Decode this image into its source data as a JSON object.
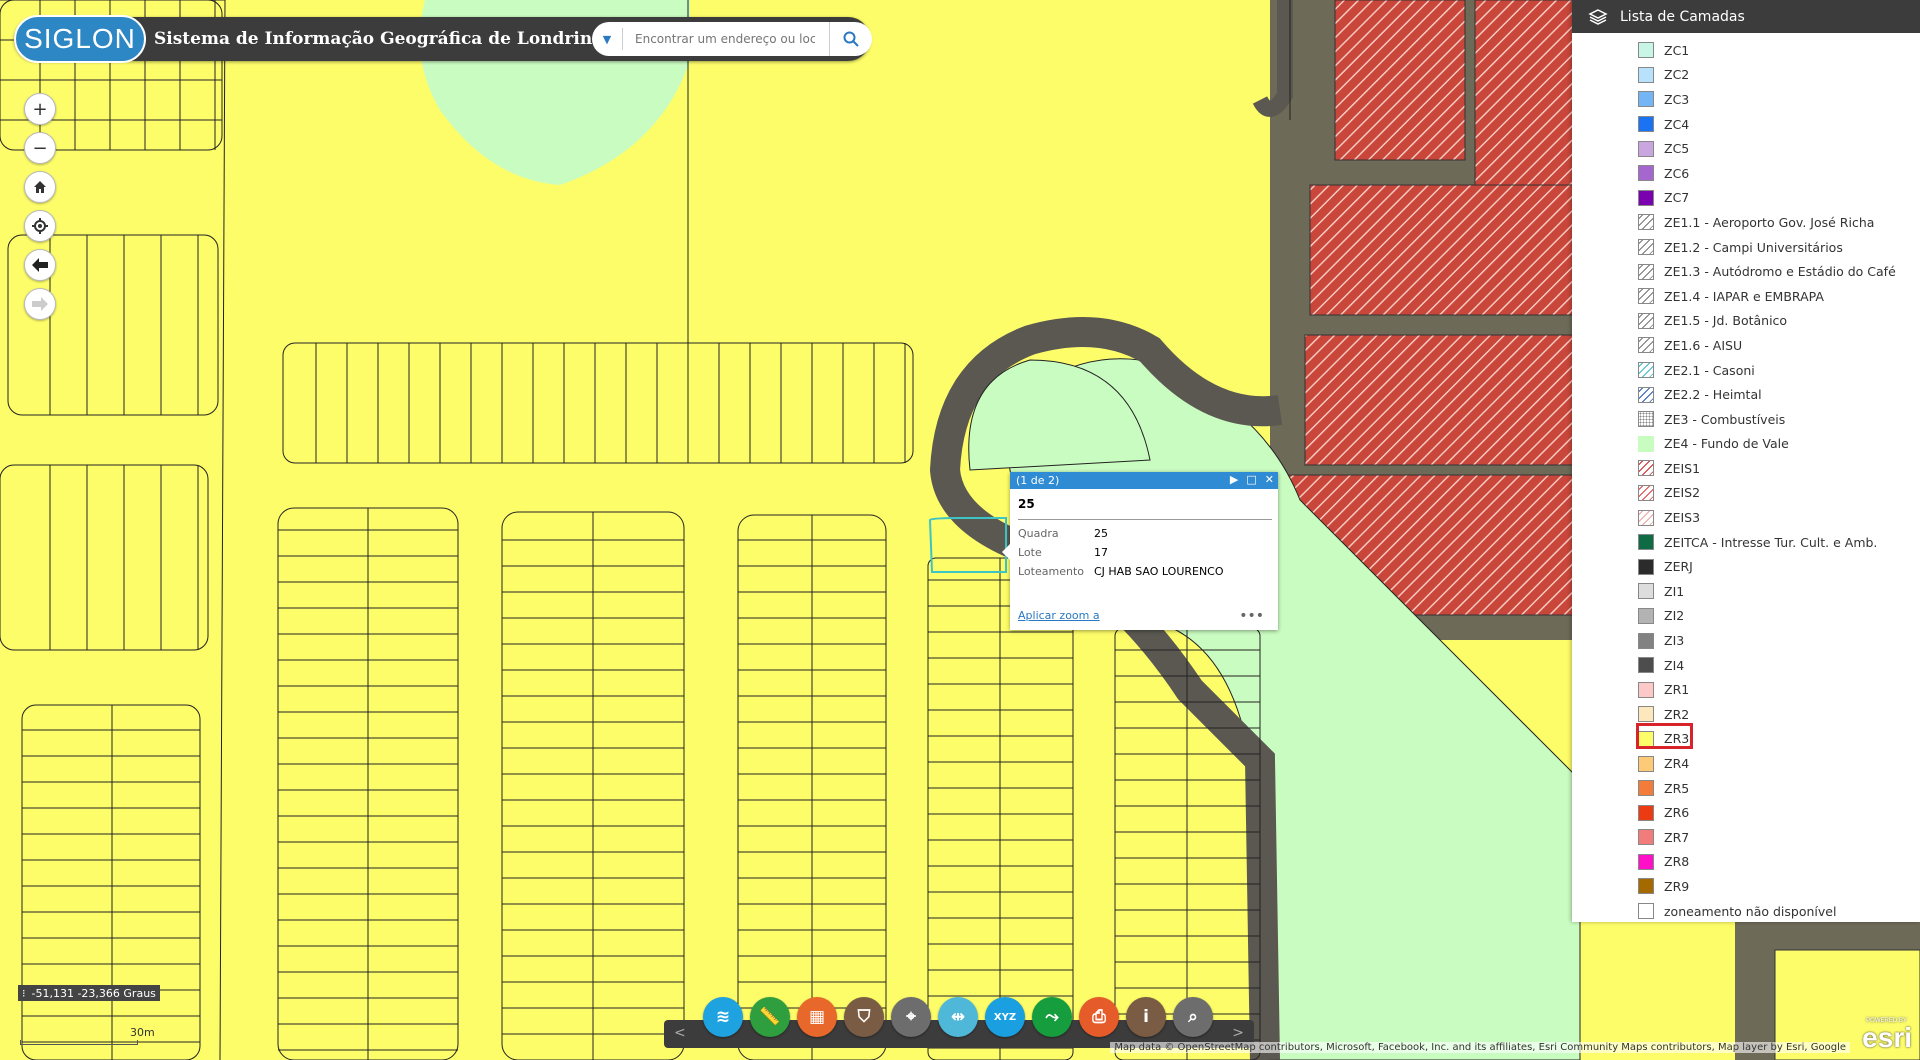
{
  "header": {
    "logo_text": "SIGLON",
    "title": "Sistema de Informação Geográfica de Londrina",
    "search_placeholder": "Encontrar um endereço ou local"
  },
  "map_tools": [
    "plus-icon",
    "minus-icon",
    "home-icon",
    "locate-icon",
    "back-icon",
    "forward-icon"
  ],
  "popup": {
    "header": "(1 de 2)",
    "title": "25",
    "fields": [
      {
        "key": "Quadra",
        "value": "25"
      },
      {
        "key": "Lote",
        "value": "17"
      },
      {
        "key": "Loteamento",
        "value": "CJ HAB SAO LOURENCO"
      }
    ],
    "zoom_link": "Aplicar zoom a",
    "more": "•••"
  },
  "layers_panel": {
    "title": "Lista de Camadas",
    "items": [
      {
        "label": "ZC1",
        "color": "#c8f5e6",
        "pattern": "solid"
      },
      {
        "label": "ZC2",
        "color": "#b8e2fb",
        "pattern": "solid"
      },
      {
        "label": "ZC3",
        "color": "#73b5f5",
        "pattern": "solid"
      },
      {
        "label": "ZC4",
        "color": "#1a73f2",
        "pattern": "solid"
      },
      {
        "label": "ZC5",
        "color": "#c9a6e0",
        "pattern": "solid"
      },
      {
        "label": "ZC6",
        "color": "#a566cf",
        "pattern": "solid"
      },
      {
        "label": "ZC7",
        "color": "#7a00b0",
        "pattern": "solid"
      },
      {
        "label": "ZE1.1 - Aeroporto Gov. José Richa",
        "color": "#777777",
        "pattern": "hatch"
      },
      {
        "label": "ZE1.2 - Campi Universitários",
        "color": "#777777",
        "pattern": "hatch"
      },
      {
        "label": "ZE1.3 - Autódromo e Estádio do Café",
        "color": "#777777",
        "pattern": "hatch"
      },
      {
        "label": "ZE1.4 - IAPAR e EMBRAPA",
        "color": "#777777",
        "pattern": "hatch"
      },
      {
        "label": "ZE1.5 - Jd. Botânico",
        "color": "#777777",
        "pattern": "hatch"
      },
      {
        "label": "ZE1.6 - AISU",
        "color": "#777777",
        "pattern": "hatch"
      },
      {
        "label": "ZE2.1 - Casoni",
        "color": "#3fb8c8",
        "pattern": "hatch"
      },
      {
        "label": "ZE2.2 - Heimtal",
        "color": "#2a5db0",
        "pattern": "hatch"
      },
      {
        "label": "ZE3 - Combustíveis",
        "color": "#888888",
        "pattern": "dots"
      },
      {
        "label": "ZE4 - Fundo de Vale",
        "color": "#c9fcc0",
        "pattern": "solid-noborder"
      },
      {
        "label": "ZEIS1",
        "color": "#cc2a2a",
        "pattern": "hatch"
      },
      {
        "label": "ZEIS2",
        "color": "#d84545",
        "pattern": "hatch"
      },
      {
        "label": "ZEIS3",
        "color": "#f2a0a0",
        "pattern": "hatch"
      },
      {
        "label": "ZEITCA - Intresse Tur. Cult. e Amb.",
        "color": "#0f6b45",
        "pattern": "solid"
      },
      {
        "label": "ZERJ",
        "color": "#2b2b2b",
        "pattern": "solid"
      },
      {
        "label": "ZI1",
        "color": "#dddddd",
        "pattern": "solid"
      },
      {
        "label": "ZI2",
        "color": "#b3b3b3",
        "pattern": "solid"
      },
      {
        "label": "ZI3",
        "color": "#828282",
        "pattern": "solid"
      },
      {
        "label": "ZI4",
        "color": "#4d4d4d",
        "pattern": "solid"
      },
      {
        "label": "ZR1",
        "color": "#fdc8c8",
        "pattern": "solid"
      },
      {
        "label": "ZR2",
        "color": "#fde8bd",
        "pattern": "solid"
      },
      {
        "label": "ZR3",
        "color": "#fdfd6a",
        "pattern": "solid"
      },
      {
        "label": "ZR4",
        "color": "#fdca78",
        "pattern": "solid"
      },
      {
        "label": "ZR5",
        "color": "#f37c3a",
        "pattern": "solid"
      },
      {
        "label": "ZR6",
        "color": "#ec3a12",
        "pattern": "solid"
      },
      {
        "label": "ZR7",
        "color": "#f27c7c",
        "pattern": "solid"
      },
      {
        "label": "ZR8",
        "color": "#ff10c8",
        "pattern": "solid"
      },
      {
        "label": "ZR9",
        "color": "#a46a00",
        "pattern": "solid"
      },
      {
        "label": "zoneamento não disponível",
        "color": "#ffffff",
        "pattern": "solid"
      }
    ]
  },
  "coords_text": "-51,131 -23,366 Graus",
  "scale_text": "30m",
  "toolbar": [
    {
      "name": "layers-icon",
      "color": "#1fa3e0"
    },
    {
      "name": "measure-icon",
      "color": "#2e9e3e"
    },
    {
      "name": "basemap-icon",
      "color": "#e8672a"
    },
    {
      "name": "filter-icon",
      "color": "#7a5c44"
    },
    {
      "name": "route-icon",
      "color": "#6d6d6d"
    },
    {
      "name": "swipe-icon",
      "color": "#4fb8d8"
    },
    {
      "name": "xyz-icon",
      "color": "#1a9fe0"
    },
    {
      "name": "share-icon",
      "color": "#159d3e"
    },
    {
      "name": "print-icon",
      "color": "#e65b2a"
    },
    {
      "name": "info-icon",
      "color": "#7a5c44"
    },
    {
      "name": "search-map-icon",
      "color": "#6d6d6d"
    }
  ],
  "attribution": "Map data © OpenStreetMap contributors, Microsoft, Facebook, Inc. and its affiliates, Esri Community Maps contributors, Map layer by Esri, Google",
  "esri_logo": "esri",
  "esri_small": "POWERED BY"
}
